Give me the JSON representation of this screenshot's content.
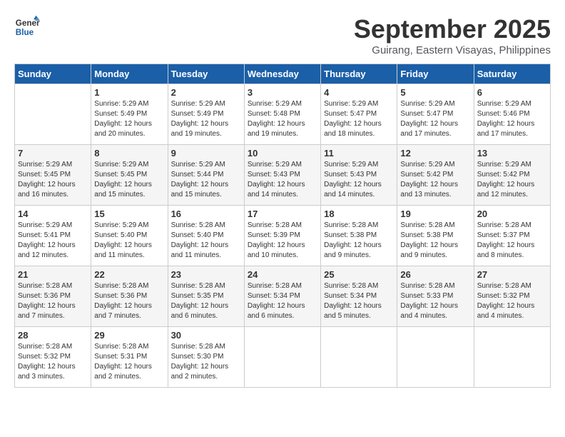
{
  "header": {
    "logo_line1": "General",
    "logo_line2": "Blue",
    "month": "September 2025",
    "location": "Guirang, Eastern Visayas, Philippines"
  },
  "weekdays": [
    "Sunday",
    "Monday",
    "Tuesday",
    "Wednesday",
    "Thursday",
    "Friday",
    "Saturday"
  ],
  "weeks": [
    [
      {
        "day": "",
        "info": ""
      },
      {
        "day": "1",
        "info": "Sunrise: 5:29 AM\nSunset: 5:49 PM\nDaylight: 12 hours\nand 20 minutes."
      },
      {
        "day": "2",
        "info": "Sunrise: 5:29 AM\nSunset: 5:49 PM\nDaylight: 12 hours\nand 19 minutes."
      },
      {
        "day": "3",
        "info": "Sunrise: 5:29 AM\nSunset: 5:48 PM\nDaylight: 12 hours\nand 19 minutes."
      },
      {
        "day": "4",
        "info": "Sunrise: 5:29 AM\nSunset: 5:47 PM\nDaylight: 12 hours\nand 18 minutes."
      },
      {
        "day": "5",
        "info": "Sunrise: 5:29 AM\nSunset: 5:47 PM\nDaylight: 12 hours\nand 17 minutes."
      },
      {
        "day": "6",
        "info": "Sunrise: 5:29 AM\nSunset: 5:46 PM\nDaylight: 12 hours\nand 17 minutes."
      }
    ],
    [
      {
        "day": "7",
        "info": "Sunrise: 5:29 AM\nSunset: 5:45 PM\nDaylight: 12 hours\nand 16 minutes."
      },
      {
        "day": "8",
        "info": "Sunrise: 5:29 AM\nSunset: 5:45 PM\nDaylight: 12 hours\nand 15 minutes."
      },
      {
        "day": "9",
        "info": "Sunrise: 5:29 AM\nSunset: 5:44 PM\nDaylight: 12 hours\nand 15 minutes."
      },
      {
        "day": "10",
        "info": "Sunrise: 5:29 AM\nSunset: 5:43 PM\nDaylight: 12 hours\nand 14 minutes."
      },
      {
        "day": "11",
        "info": "Sunrise: 5:29 AM\nSunset: 5:43 PM\nDaylight: 12 hours\nand 14 minutes."
      },
      {
        "day": "12",
        "info": "Sunrise: 5:29 AM\nSunset: 5:42 PM\nDaylight: 12 hours\nand 13 minutes."
      },
      {
        "day": "13",
        "info": "Sunrise: 5:29 AM\nSunset: 5:42 PM\nDaylight: 12 hours\nand 12 minutes."
      }
    ],
    [
      {
        "day": "14",
        "info": "Sunrise: 5:29 AM\nSunset: 5:41 PM\nDaylight: 12 hours\nand 12 minutes."
      },
      {
        "day": "15",
        "info": "Sunrise: 5:29 AM\nSunset: 5:40 PM\nDaylight: 12 hours\nand 11 minutes."
      },
      {
        "day": "16",
        "info": "Sunrise: 5:28 AM\nSunset: 5:40 PM\nDaylight: 12 hours\nand 11 minutes."
      },
      {
        "day": "17",
        "info": "Sunrise: 5:28 AM\nSunset: 5:39 PM\nDaylight: 12 hours\nand 10 minutes."
      },
      {
        "day": "18",
        "info": "Sunrise: 5:28 AM\nSunset: 5:38 PM\nDaylight: 12 hours\nand 9 minutes."
      },
      {
        "day": "19",
        "info": "Sunrise: 5:28 AM\nSunset: 5:38 PM\nDaylight: 12 hours\nand 9 minutes."
      },
      {
        "day": "20",
        "info": "Sunrise: 5:28 AM\nSunset: 5:37 PM\nDaylight: 12 hours\nand 8 minutes."
      }
    ],
    [
      {
        "day": "21",
        "info": "Sunrise: 5:28 AM\nSunset: 5:36 PM\nDaylight: 12 hours\nand 7 minutes."
      },
      {
        "day": "22",
        "info": "Sunrise: 5:28 AM\nSunset: 5:36 PM\nDaylight: 12 hours\nand 7 minutes."
      },
      {
        "day": "23",
        "info": "Sunrise: 5:28 AM\nSunset: 5:35 PM\nDaylight: 12 hours\nand 6 minutes."
      },
      {
        "day": "24",
        "info": "Sunrise: 5:28 AM\nSunset: 5:34 PM\nDaylight: 12 hours\nand 6 minutes."
      },
      {
        "day": "25",
        "info": "Sunrise: 5:28 AM\nSunset: 5:34 PM\nDaylight: 12 hours\nand 5 minutes."
      },
      {
        "day": "26",
        "info": "Sunrise: 5:28 AM\nSunset: 5:33 PM\nDaylight: 12 hours\nand 4 minutes."
      },
      {
        "day": "27",
        "info": "Sunrise: 5:28 AM\nSunset: 5:32 PM\nDaylight: 12 hours\nand 4 minutes."
      }
    ],
    [
      {
        "day": "28",
        "info": "Sunrise: 5:28 AM\nSunset: 5:32 PM\nDaylight: 12 hours\nand 3 minutes."
      },
      {
        "day": "29",
        "info": "Sunrise: 5:28 AM\nSunset: 5:31 PM\nDaylight: 12 hours\nand 2 minutes."
      },
      {
        "day": "30",
        "info": "Sunrise: 5:28 AM\nSunset: 5:30 PM\nDaylight: 12 hours\nand 2 minutes."
      },
      {
        "day": "",
        "info": ""
      },
      {
        "day": "",
        "info": ""
      },
      {
        "day": "",
        "info": ""
      },
      {
        "day": "",
        "info": ""
      }
    ]
  ]
}
